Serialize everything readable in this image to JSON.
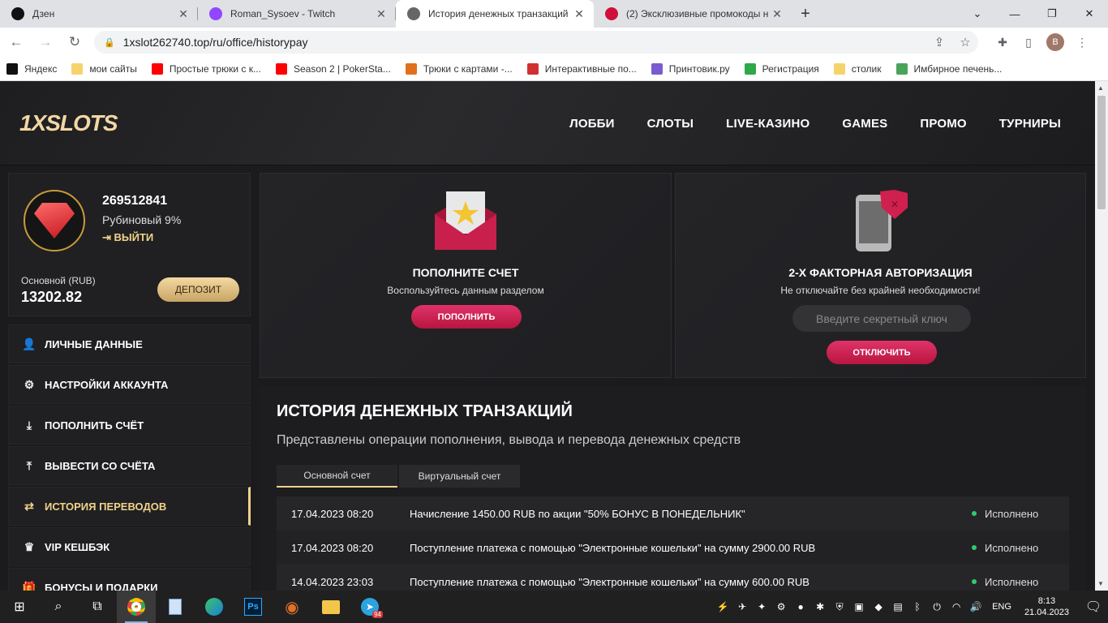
{
  "browser": {
    "tabs": [
      {
        "title": "Дзен",
        "icon": "dzen-icon",
        "color": "#111111",
        "active": false
      },
      {
        "title": "Roman_Sysoev - Twitch",
        "icon": "twitch-icon",
        "color": "#9146ff",
        "active": false
      },
      {
        "title": "История денежных транзакций",
        "icon": "1xslots-icon",
        "color": "#666666",
        "active": true
      },
      {
        "title": "(2) Эксклюзивные промокоды н",
        "icon": "promo-icon",
        "color": "#d0103a",
        "active": false
      }
    ],
    "url": "1xslot262740.top/ru/office/historypay",
    "profile_initial": "B",
    "bookmarks": [
      {
        "label": "Яндекс",
        "color": "#111111"
      },
      {
        "label": "мои сайты",
        "color": "#f6d36b"
      },
      {
        "label": "Простые трюки с к...",
        "color": "#ff0000"
      },
      {
        "label": "Season 2 | PokerSta...",
        "color": "#ff0000"
      },
      {
        "label": "Трюки с картами -...",
        "color": "#e0701a"
      },
      {
        "label": "Интерактивные по...",
        "color": "#d03030"
      },
      {
        "label": "Принтовик.ру",
        "color": "#7a5cd0"
      },
      {
        "label": "Регистрация",
        "color": "#2ea84a"
      },
      {
        "label": "столик",
        "color": "#f6d36b"
      },
      {
        "label": "Имбирное печень...",
        "color": "#4aa35a"
      }
    ]
  },
  "site": {
    "logo": "1XSLOTS",
    "nav": [
      "ЛОББИ",
      "СЛОТЫ",
      "LIVE-КАЗИНО",
      "GAMES",
      "ПРОМО",
      "ТУРНИРЫ"
    ],
    "profile": {
      "user_id": "269512841",
      "level": "Рубиновый 9%",
      "logout": "ВЫЙТИ",
      "balance_label": "Основной (RUB)",
      "balance": "13202.82",
      "deposit_btn": "ДЕПОЗИТ"
    },
    "menu": [
      {
        "label": "ЛИЧНЫЕ ДАННЫЕ",
        "icon": "user-add-icon",
        "glyph": "👤"
      },
      {
        "label": "НАСТРОЙКИ АККАУНТА",
        "icon": "gears-icon",
        "glyph": "⚙"
      },
      {
        "label": "ПОПОЛНИТЬ СЧЁТ",
        "icon": "download-icon",
        "glyph": "⤓"
      },
      {
        "label": "ВЫВЕСТИ СО СЧЁТА",
        "icon": "upload-icon",
        "glyph": "⤒"
      },
      {
        "label": "ИСТОРИЯ ПЕРЕВОДОВ",
        "icon": "transfer-icon",
        "glyph": "⇄",
        "active": true
      },
      {
        "label": "VIP КЕШБЭК",
        "icon": "crown-icon",
        "glyph": "♛"
      },
      {
        "label": "БОНУСЫ И ПОДАРКИ",
        "icon": "gift-icon",
        "glyph": "🎁"
      }
    ],
    "deposit_card": {
      "title": "ПОПОЛНИТЕ СЧЕТ",
      "subtitle": "Воспользуйтесь данным разделом",
      "button": "ПОПОЛНИТЬ"
    },
    "twofa_card": {
      "title": "2-Х ФАКТОРНАЯ АВТОРИЗАЦИЯ",
      "subtitle": "Не отключайте без крайней необходимости!",
      "placeholder": "Введите секретный ключ",
      "button": "ОТКЛЮЧИТЬ"
    },
    "history": {
      "title": "ИСТОРИЯ ДЕНЕЖНЫХ ТРАНЗАКЦИЙ",
      "subtitle": "Представлены операции пополнения, вывода и перевода денежных средств",
      "tabs": [
        "Основной счет",
        "Виртуальный счет"
      ],
      "rows": [
        {
          "date": "17.04.2023 08:20",
          "text": "Начисление 1450.00 RUB по акции \"50% БОНУС В ПОНЕДЕЛЬНИК\"",
          "status": "Исполнено"
        },
        {
          "date": "17.04.2023 08:20",
          "text": "Поступление платежа с помощью \"Электронные кошельки\" на сумму 2900.00 RUB",
          "status": "Исполнено"
        },
        {
          "date": "14.04.2023 23:03",
          "text": "Поступление платежа с помощью \"Электронные кошельки\" на сумму 600.00 RUB",
          "status": "Исполнено"
        }
      ]
    }
  },
  "taskbar": {
    "lang": "ENG",
    "time": "8:13",
    "date": "21.04.2023",
    "telegram_badge": "94"
  }
}
